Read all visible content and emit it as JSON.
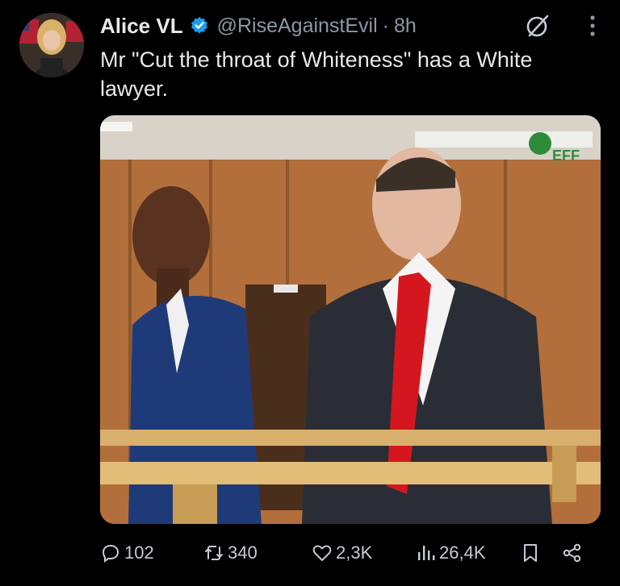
{
  "author": {
    "name": "Alice VL",
    "handle": "@RiseAgainstEvil",
    "separator": "·",
    "time": "8h"
  },
  "tweet": {
    "text": "Mr \"Cut the throat of Whiteness\" has a White lawyer."
  },
  "media": {
    "watermark": "EFF"
  },
  "actions": {
    "replies": "102",
    "retweets": "340",
    "likes": "2,3K",
    "views": "26,4K"
  },
  "icons": {
    "verified": "verified-badge-icon",
    "grok": "grok-icon",
    "more": "more-icon",
    "reply": "reply-icon",
    "retweet": "retweet-icon",
    "like": "heart-icon",
    "views": "views-icon",
    "bookmark": "bookmark-icon",
    "share": "share-icon"
  },
  "colors": {
    "background": "#000000",
    "text": "#e7e9ea",
    "muted": "#8b98a5",
    "verified": "#1d9bf0"
  }
}
